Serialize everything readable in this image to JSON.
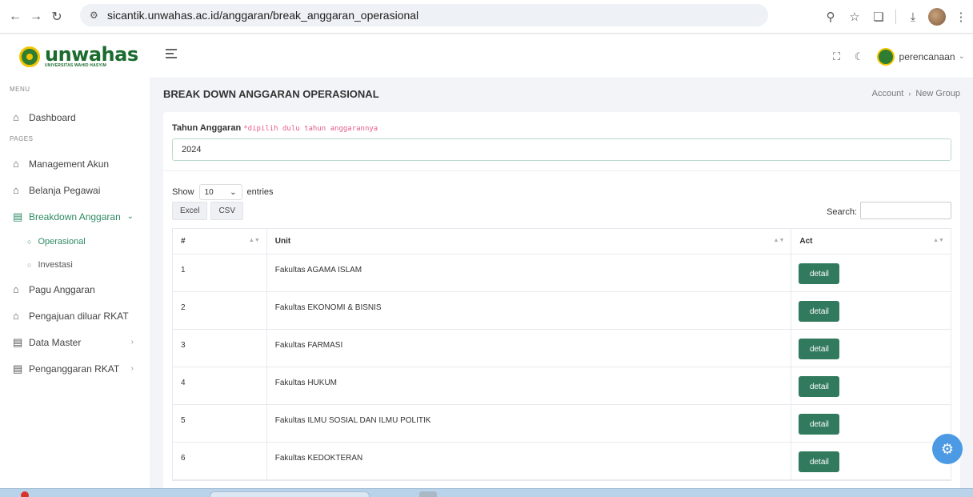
{
  "browser": {
    "url": "sicantik.unwahas.ac.id/anggaran/break_anggaran_operasional"
  },
  "app": {
    "logo_text": "unwahas",
    "logo_sub": "UNIVERSITAS WAHID HASYIM",
    "user": "perencanaan"
  },
  "sidebar": {
    "menu_title": "MENU",
    "pages_title": "PAGES",
    "dashboard": "Dashboard",
    "items": [
      {
        "label": "Management Akun"
      },
      {
        "label": "Belanja Pegawai"
      },
      {
        "label": "Breakdown Anggaran"
      }
    ],
    "sub_items": [
      {
        "label": "Operasional"
      },
      {
        "label": "Investasi"
      }
    ],
    "items2": [
      {
        "label": "Pagu Anggaran"
      },
      {
        "label": "Pengajuan diluar RKAT"
      },
      {
        "label": "Data Master"
      },
      {
        "label": "Penganggaran RKAT"
      }
    ],
    "active_color": "#2e8b62"
  },
  "page": {
    "title": "BREAK DOWN ANGGARAN OPERASIONAL",
    "breadcrumb": [
      "Account",
      "New Group"
    ]
  },
  "form": {
    "year_label": "Tahun Anggaran",
    "year_hint": "*dipilih dulu tahun anggarannya",
    "year_value": "2024"
  },
  "table_controls": {
    "show": "Show",
    "entries_value": "10",
    "entries": "entries",
    "excel": "Excel",
    "csv": "CSV",
    "search": "Search:"
  },
  "table": {
    "headers": [
      "#",
      "Unit",
      "Act"
    ],
    "button_label": "detail",
    "button_color": "#327a5e",
    "rows": [
      {
        "no": "1",
        "unit": "Fakultas AGAMA ISLAM"
      },
      {
        "no": "2",
        "unit": "Fakultas EKONOMI & BISNIS"
      },
      {
        "no": "3",
        "unit": "Fakultas FARMASI"
      },
      {
        "no": "4",
        "unit": "Fakultas HUKUM"
      },
      {
        "no": "5",
        "unit": "Fakultas ILMU SOSIAL DAN ILMU POLITIK"
      },
      {
        "no": "6",
        "unit": "Fakultas KEDOKTERAN"
      }
    ]
  }
}
